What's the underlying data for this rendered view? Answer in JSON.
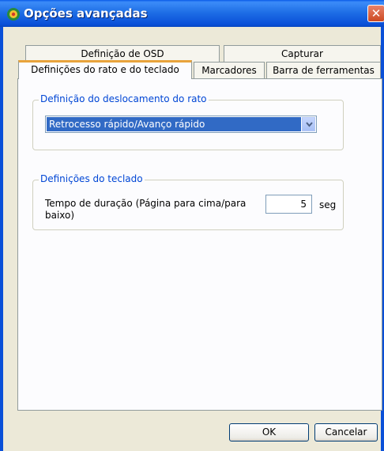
{
  "window": {
    "title": "Opções avançadas",
    "close_glyph": "✕"
  },
  "tabs": {
    "row1": [
      "Definição de OSD",
      "Capturar"
    ],
    "row2": [
      "Definições do rato e do teclado",
      "Marcadores",
      "Barra de ferramentas"
    ],
    "active": "Definições do rato e do teclado"
  },
  "mouse_group": {
    "legend": "Definição do deslocamento do rato",
    "selected_option": "Retrocesso rápido/Avanço rápido"
  },
  "keyboard_group": {
    "legend": "Definições do teclado",
    "duration_label": "Tempo de duração (Página para cima/para baixo)",
    "duration_value": "5",
    "unit": "seg"
  },
  "buttons": {
    "ok": "OK",
    "cancel": "Cancelar"
  },
  "icons": {
    "app": "app-icon",
    "close": "close-icon",
    "dropdown": "chevron-down-icon"
  },
  "colors": {
    "titlebar": "#0a50d8",
    "active_tab_accent": "#e8a33c",
    "legend_text": "#0046d5",
    "selection": "#316ac5"
  }
}
